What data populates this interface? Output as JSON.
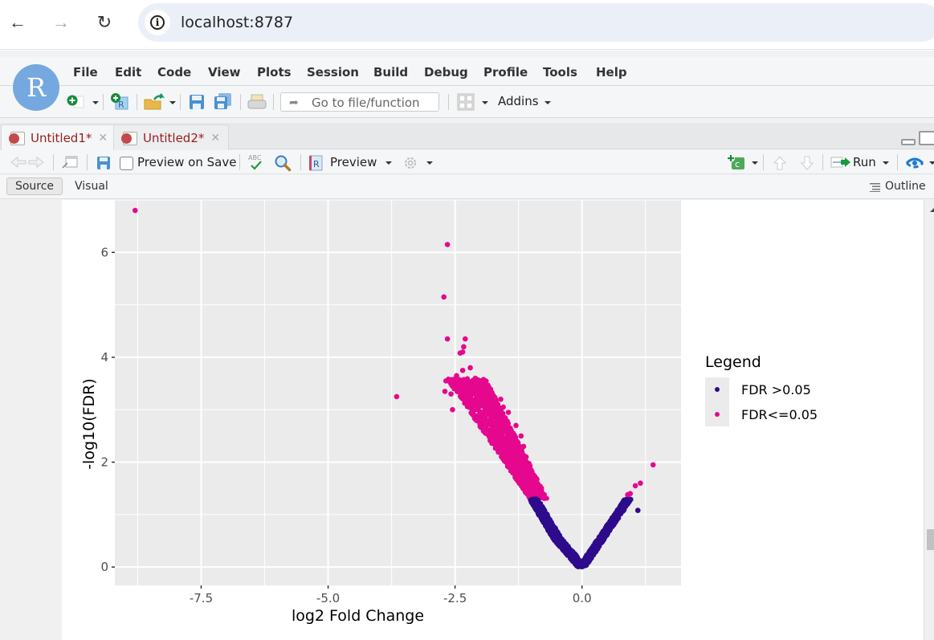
{
  "browser": {
    "url": "localhost:8787",
    "back_icon": "arrow-left",
    "forward_icon": "arrow-right",
    "reload_icon": "reload"
  },
  "app": {
    "logo_letter": "R",
    "menu": [
      "File",
      "Edit",
      "Code",
      "View",
      "Plots",
      "Session",
      "Build",
      "Debug",
      "Profile",
      "Tools",
      "Help"
    ],
    "goto_placeholder": "Go to file/function",
    "addins_label": "Addins"
  },
  "editor": {
    "tabs": [
      {
        "label": "Untitled1*",
        "active": true
      },
      {
        "label": "Untitled2*",
        "active": false
      }
    ],
    "toolbar": {
      "preview_on_save_label": "Preview on Save",
      "preview_on_save_checked": false,
      "preview_label": "Preview",
      "run_label": "Run",
      "spellcheck_label": "ABC"
    },
    "modes": {
      "source_label": "Source",
      "visual_label": "Visual",
      "outline_label": "Outline"
    }
  },
  "chart_data": {
    "type": "scatter",
    "title": "",
    "xlabel": "log2 Fold Change",
    "ylabel": "-log10(FDR)",
    "xlim": [
      -9.2,
      1.95
    ],
    "ylim": [
      -0.35,
      7.0
    ],
    "x_ticks": [
      -7.5,
      -5.0,
      -2.5,
      0.0
    ],
    "x_tick_labels": [
      "-7.5",
      "-5.0",
      "-2.5",
      "0.0"
    ],
    "y_ticks": [
      0,
      2,
      4,
      6
    ],
    "y_tick_labels": [
      "0",
      "2",
      "4",
      "6"
    ],
    "grid": true,
    "background": "#ebebeb",
    "legend": {
      "title": "Legend",
      "position": "right",
      "entries": [
        {
          "label": "FDR >0.05",
          "color": "#2e0a8c"
        },
        {
          "label": "FDR<=0.05",
          "color": "#e5088e"
        }
      ]
    },
    "fdr_threshold_neglog10": 1.3,
    "series": [
      {
        "name": "FDR<=0.05",
        "color": "#e5088e",
        "points": [
          [
            -8.8,
            6.8
          ],
          [
            -2.65,
            6.15
          ],
          [
            -2.72,
            5.15
          ],
          [
            -2.65,
            4.35
          ],
          [
            -2.3,
            4.35
          ],
          [
            -2.33,
            4.2
          ],
          [
            -2.35,
            4.1
          ],
          [
            -2.4,
            4.08
          ],
          [
            -3.65,
            3.25
          ],
          [
            -2.68,
            3.55
          ],
          [
            -2.7,
            3.35
          ],
          [
            -2.58,
            3.3
          ],
          [
            -2.55,
            3.0
          ],
          [
            -2.47,
            3.65
          ],
          [
            -2.35,
            3.75
          ],
          [
            -2.2,
            3.8
          ],
          [
            -2.1,
            3.6
          ],
          [
            -1.98,
            3.55
          ],
          [
            -1.9,
            3.4
          ],
          [
            -1.85,
            3.3
          ],
          [
            -1.75,
            3.25
          ],
          [
            -1.6,
            3.2
          ],
          [
            -1.55,
            3.05
          ],
          [
            -1.45,
            2.95
          ],
          [
            -1.3,
            2.7
          ],
          [
            -1.2,
            2.5
          ],
          [
            -1.15,
            2.3
          ],
          [
            -1.1,
            2.1
          ],
          [
            -1.05,
            1.9
          ],
          [
            -1.0,
            1.7
          ],
          [
            -0.95,
            1.55
          ],
          [
            -0.9,
            1.4
          ],
          [
            1.4,
            1.95
          ],
          [
            1.15,
            1.6
          ],
          [
            1.05,
            1.55
          ],
          [
            0.95,
            1.4
          ],
          [
            0.9,
            1.38
          ]
        ]
      },
      {
        "name": "FDR >0.05",
        "color": "#2e0a8c",
        "points": [
          [
            1.1,
            1.08
          ]
        ]
      }
    ],
    "dense_regions": [
      {
        "series": "FDR<=0.05",
        "description": "left arm band",
        "x_range": [
          -2.3,
          -0.85
        ],
        "y_range": [
          1.3,
          3.6
        ]
      },
      {
        "series": "FDR >0.05",
        "description": "left arm band",
        "x_range": [
          -1.3,
          0.0
        ],
        "y_range": [
          0.0,
          1.3
        ]
      },
      {
        "series": "FDR >0.05",
        "description": "right arm band",
        "x_range": [
          0.0,
          1.0
        ],
        "y_range": [
          0.0,
          1.3
        ]
      }
    ]
  }
}
